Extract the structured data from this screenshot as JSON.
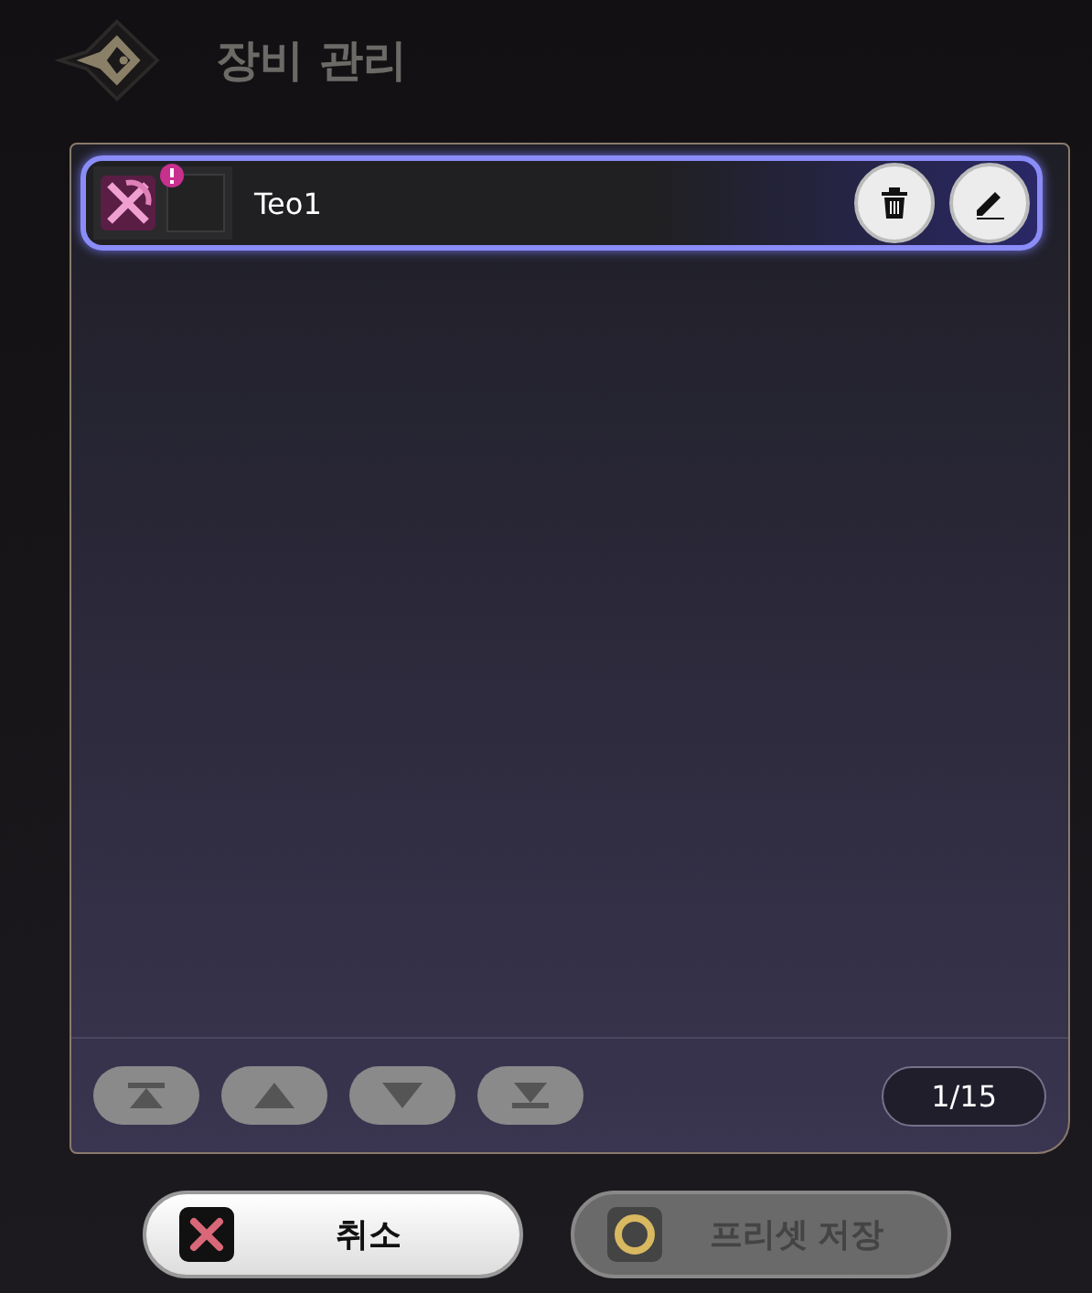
{
  "window": {
    "title": "장비 관리"
  },
  "presets": [
    {
      "name": "Teo1",
      "selected": true,
      "warning": true
    }
  ],
  "pager": {
    "page": "1/15",
    "nav": [
      {
        "kind": "first"
      },
      {
        "kind": "up"
      },
      {
        "kind": "down"
      },
      {
        "kind": "last"
      }
    ]
  },
  "buttons": [
    {
      "label": "취소",
      "kind": "cancel",
      "disabled": false
    },
    {
      "label": "프리셋 저장",
      "kind": "save",
      "disabled": true
    }
  ]
}
